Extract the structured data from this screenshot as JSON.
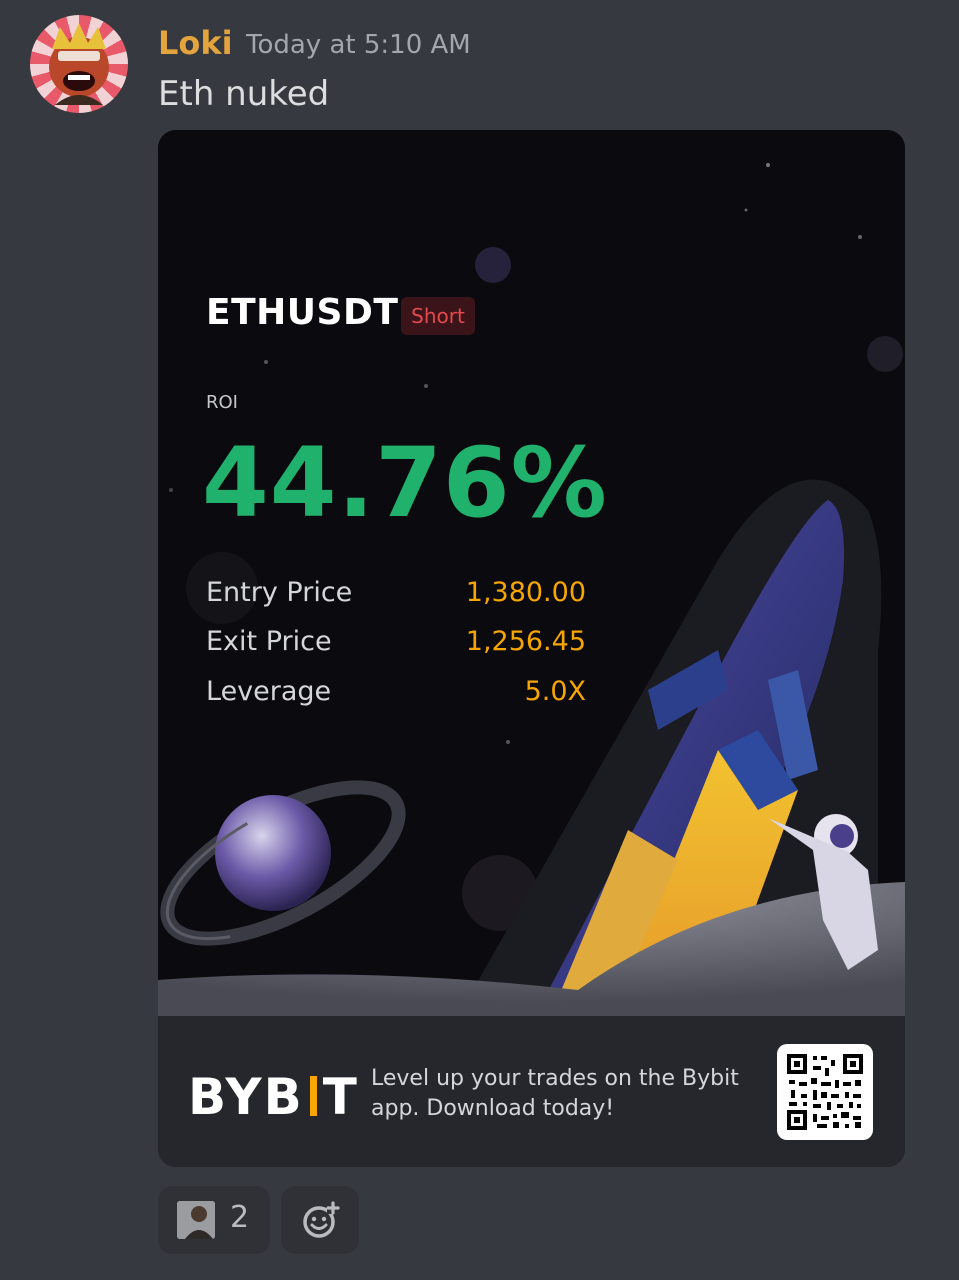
{
  "message": {
    "username": "Loki",
    "timestamp": "Today at 5:10 AM",
    "text": "Eth nuked",
    "username_color": "#e3a33d"
  },
  "card": {
    "pair": "ETHUSDT",
    "side": "Short",
    "roi_label": "ROI",
    "roi_value": "44.76%",
    "stats": [
      {
        "label": "Entry Price",
        "value": "1,380.00"
      },
      {
        "label": "Exit Price",
        "value": "1,256.45"
      },
      {
        "label": "Leverage",
        "value": "5.0X"
      }
    ],
    "colors": {
      "roi": "#20b26c",
      "short": "#e5484d",
      "accent": "#f7a600"
    },
    "footer": {
      "logo": "BYBIT",
      "promo_text": "Level up your trades on the Bybit app. Download today!"
    }
  },
  "reactions": [
    {
      "icon": "user-photo-reaction",
      "count": "2"
    },
    {
      "icon": "add-reaction-icon"
    }
  ]
}
